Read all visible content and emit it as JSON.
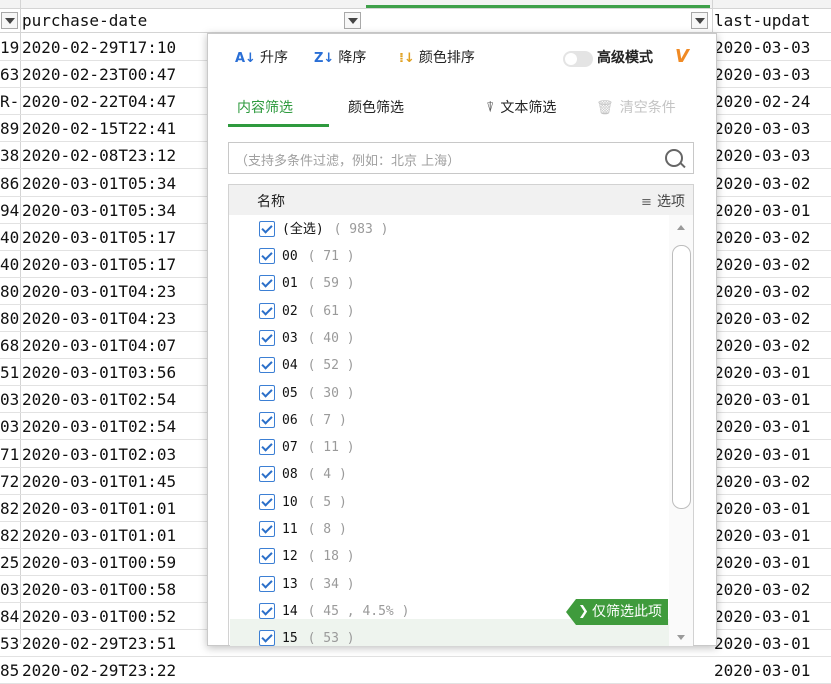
{
  "sheet": {
    "left_col_header": "purchase-date",
    "right_col_header": "last-updat",
    "left_prefixes": [
      "19",
      "63",
      "R-",
      "89",
      "38",
      "86",
      "94",
      "40",
      "40",
      "80",
      "80",
      "68",
      "51",
      "03",
      "03",
      "71",
      "72",
      "82",
      "82",
      "25",
      "03",
      "84",
      "53",
      "85"
    ],
    "dates": [
      "2020-02-29T17:10",
      "2020-02-23T00:47",
      "2020-02-22T04:47",
      "2020-02-15T22:41",
      "2020-02-08T23:12",
      "2020-03-01T05:34",
      "2020-03-01T05:34",
      "2020-03-01T05:17",
      "2020-03-01T05:17",
      "2020-03-01T04:23",
      "2020-03-01T04:23",
      "2020-03-01T04:07",
      "2020-03-01T03:56",
      "2020-03-01T02:54",
      "2020-03-01T02:54",
      "2020-03-01T02:03",
      "2020-03-01T01:45",
      "2020-03-01T01:01",
      "2020-03-01T01:01",
      "2020-03-01T00:59",
      "2020-03-01T00:58",
      "2020-03-01T00:52",
      "2020-02-29T23:51",
      "2020-02-29T23:22"
    ],
    "right_dates": [
      "2020-03-03",
      "2020-03-03",
      "2020-02-24",
      "2020-03-03",
      "2020-03-03",
      "2020-03-02",
      "2020-03-01",
      "2020-03-02",
      "2020-03-02",
      "2020-03-02",
      "2020-03-02",
      "2020-03-02",
      "2020-03-01",
      "2020-03-01",
      "2020-03-01",
      "2020-03-01",
      "2020-03-02",
      "2020-03-01",
      "2020-03-01",
      "2020-03-01",
      "2020-03-02",
      "2020-03-01",
      "2020-03-01",
      "2020-03-01"
    ]
  },
  "panel": {
    "sort_asc": "升序",
    "sort_desc": "降序",
    "sort_color": "颜色排序",
    "advanced_mode": "高级模式",
    "vip_mark": "V",
    "tab_content": "内容筛选",
    "tab_color": "颜色筛选",
    "text_filter": "文本筛选",
    "clear_conditions": "清空条件",
    "search_placeholder": "（支持多条件过滤，例如：北京 上海）",
    "list_header_name": "名称",
    "list_header_options": "选项",
    "select_all_label": "(全选)",
    "select_all_count": "( 983 )",
    "items": [
      {
        "label": "00",
        "count": "( 71 )"
      },
      {
        "label": "01",
        "count": "( 59 )"
      },
      {
        "label": "02",
        "count": "( 61 )"
      },
      {
        "label": "03",
        "count": "( 40 )"
      },
      {
        "label": "04",
        "count": "( 52 )"
      },
      {
        "label": "05",
        "count": "( 30 )"
      },
      {
        "label": "06",
        "count": "( 7 )"
      },
      {
        "label": "07",
        "count": "( 11 )"
      },
      {
        "label": "08",
        "count": "( 4 )"
      },
      {
        "label": "10",
        "count": "( 5 )"
      },
      {
        "label": "11",
        "count": "( 8 )"
      },
      {
        "label": "12",
        "count": "( 18 )"
      },
      {
        "label": "13",
        "count": "( 34 )"
      },
      {
        "label": "14",
        "count": "( 45 , 4.5% )"
      },
      {
        "label": "15",
        "count": "( 53 )"
      }
    ],
    "only_filter_this": "仅筛选此项"
  },
  "colors": {
    "accent_green": "#2e9a3e",
    "checkbox_blue": "#3c7fd4",
    "vip_orange": "#f08a24"
  }
}
